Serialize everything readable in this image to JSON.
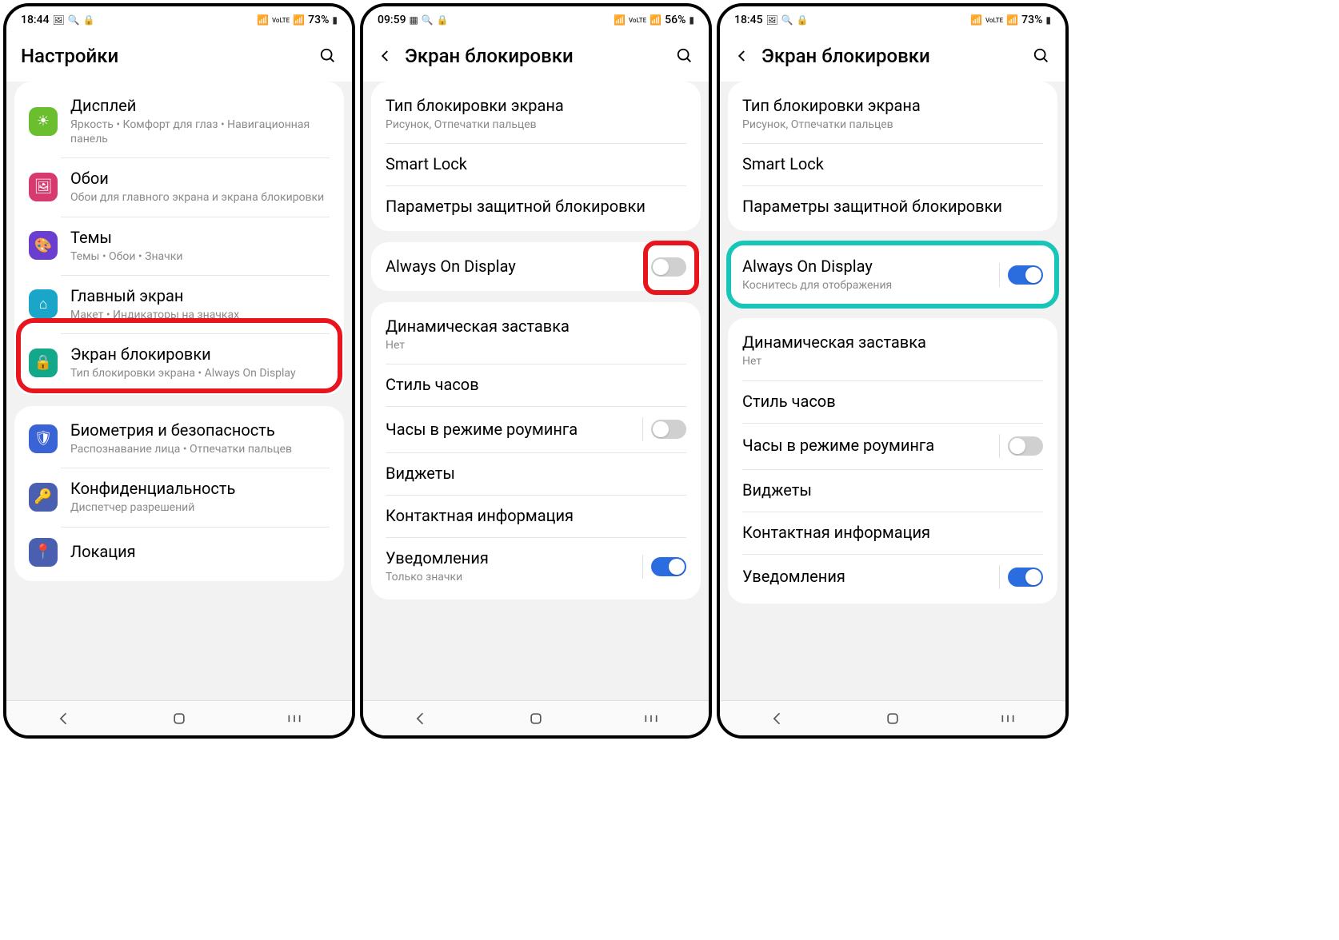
{
  "screens": [
    {
      "status": {
        "time": "18:44",
        "battery": "73%"
      },
      "header": {
        "title": "Настройки",
        "back": false
      },
      "groups": [
        {
          "items": [
            {
              "icon": "sun",
              "iconBg": "#6bbf2e",
              "title": "Дисплей",
              "sub": "Яркость  •  Комфорт для глаз  •  Навигационная панель"
            },
            {
              "icon": "image",
              "iconBg": "#d63a6f",
              "title": "Обои",
              "sub": "Обои для главного экрана и экрана блокировки"
            },
            {
              "icon": "palette",
              "iconBg": "#6a3fcf",
              "title": "Темы",
              "sub": "Темы  •  Обои  •  Значки"
            },
            {
              "icon": "home",
              "iconBg": "#1aa6c9",
              "title": "Главный экран",
              "sub": "Макет  •  Индикаторы на значках"
            },
            {
              "icon": "lock",
              "iconBg": "#14a88a",
              "title": "Экран блокировки",
              "sub": "Тип блокировки экрана  •  Always On Display",
              "highlight": "red"
            }
          ]
        },
        {
          "items": [
            {
              "icon": "shield",
              "iconBg": "#3a63d6",
              "title": "Биометрия и безопасность",
              "sub": "Распознавание лица  •  Отпечатки пальцев"
            },
            {
              "icon": "key",
              "iconBg": "#4a5fb0",
              "title": "Конфиденциальность",
              "sub": "Диспетчер разрешений"
            },
            {
              "icon": "pin",
              "iconBg": "#4a5fb0",
              "title": "Локация",
              "sub": ""
            }
          ]
        }
      ]
    },
    {
      "status": {
        "time": "09:59",
        "battery": "56%"
      },
      "header": {
        "title": "Экран блокировки",
        "back": true
      },
      "groups": [
        {
          "items": [
            {
              "title": "Тип блокировки экрана",
              "sub": "Рисунок, Отпечатки пальцев"
            },
            {
              "title": "Smart Lock"
            },
            {
              "title": "Параметры защитной блокировки"
            }
          ]
        },
        {
          "items": [
            {
              "title": "Always On Display",
              "toggle": "off",
              "highlight": "red-small"
            }
          ]
        },
        {
          "items": [
            {
              "title": "Динамическая заставка",
              "sub": "Нет"
            },
            {
              "title": "Стиль часов"
            },
            {
              "title": "Часы в режиме роуминга",
              "toggle": "off",
              "divider": true
            },
            {
              "title": "Виджеты"
            },
            {
              "title": "Контактная информация"
            },
            {
              "title": "Уведомления",
              "sub": "Только значки",
              "toggle": "on",
              "divider": true
            }
          ]
        }
      ]
    },
    {
      "status": {
        "time": "18:45",
        "battery": "73%"
      },
      "header": {
        "title": "Экран блокировки",
        "back": true
      },
      "groups": [
        {
          "items": [
            {
              "title": "Тип блокировки экрана",
              "sub": "Рисунок, Отпечатки пальцев"
            },
            {
              "title": "Smart Lock"
            },
            {
              "title": "Параметры защитной блокировки"
            }
          ]
        },
        {
          "items": [
            {
              "title": "Always On Display",
              "sub": "Коснитесь для отображения",
              "toggle": "on",
              "divider": true,
              "highlight": "teal"
            }
          ]
        },
        {
          "items": [
            {
              "title": "Динамическая заставка",
              "sub": "Нет"
            },
            {
              "title": "Стиль часов"
            },
            {
              "title": "Часы в режиме роуминга",
              "toggle": "off",
              "divider": true
            },
            {
              "title": "Виджеты"
            },
            {
              "title": "Контактная информация"
            },
            {
              "title": "Уведомления",
              "toggle": "on",
              "divider": true
            }
          ]
        }
      ]
    }
  ],
  "icons": {
    "signal_text": "VoLTE"
  }
}
